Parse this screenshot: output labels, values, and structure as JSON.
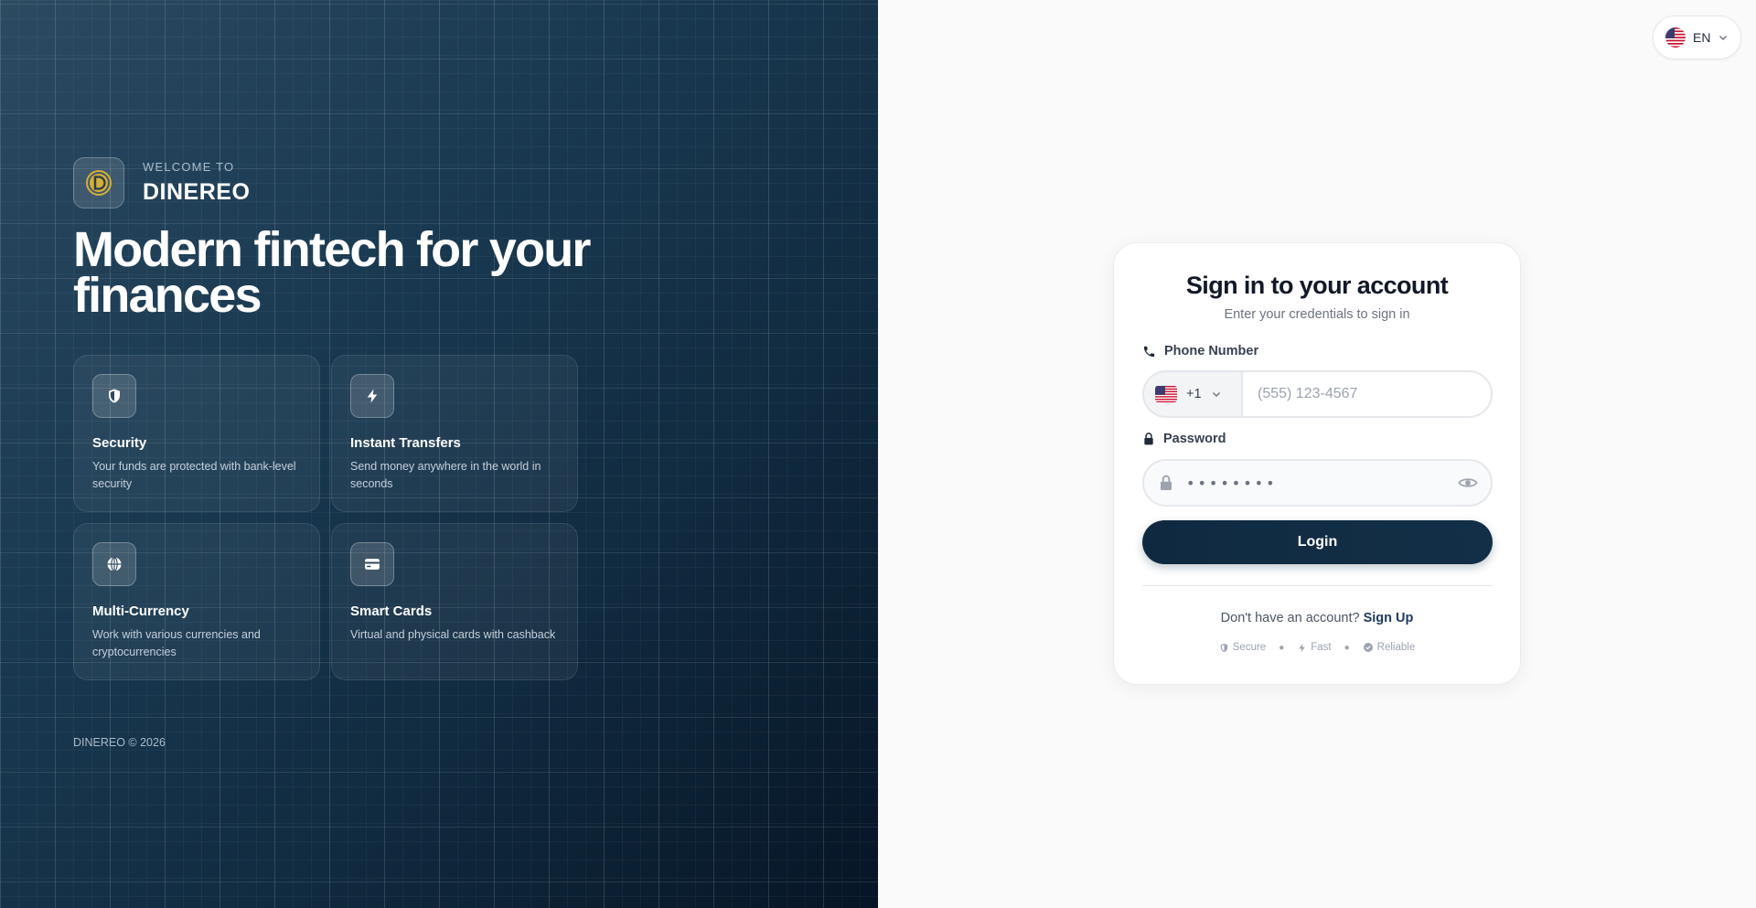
{
  "brand": {
    "welcome": "WELCOME TO",
    "name": "DINEREO",
    "headline": "Modern fintech for your finances",
    "copyright": "DINEREO © 2026"
  },
  "features": [
    {
      "title": "Security",
      "description": "Your funds are protected with bank-level security",
      "icon": "shield-icon"
    },
    {
      "title": "Instant Transfers",
      "description": "Send money anywhere in the world in seconds",
      "icon": "lightning-icon"
    },
    {
      "title": "Multi-Currency",
      "description": "Work with various currencies and cryptocurrencies",
      "icon": "globe-icon"
    },
    {
      "title": "Smart Cards",
      "description": "Virtual and physical cards with cashback",
      "icon": "card-icon"
    }
  ],
  "language": {
    "code": "EN",
    "flag": "us-flag-icon"
  },
  "login": {
    "title": "Sign in to your account",
    "subtitle": "Enter your credentials to sign in",
    "phone_label": "Phone Number",
    "country_code": "+1",
    "phone_placeholder": "(555) 123-4567",
    "password_label": "Password",
    "password_value": "••••••••",
    "login_button": "Login",
    "no_account_text": "Don't have an account?",
    "signup_link": "Sign Up",
    "trust": [
      "Secure",
      "Fast",
      "Reliable"
    ]
  },
  "colors": {
    "navy": "#0f2a40",
    "gold": "#d4af37"
  }
}
